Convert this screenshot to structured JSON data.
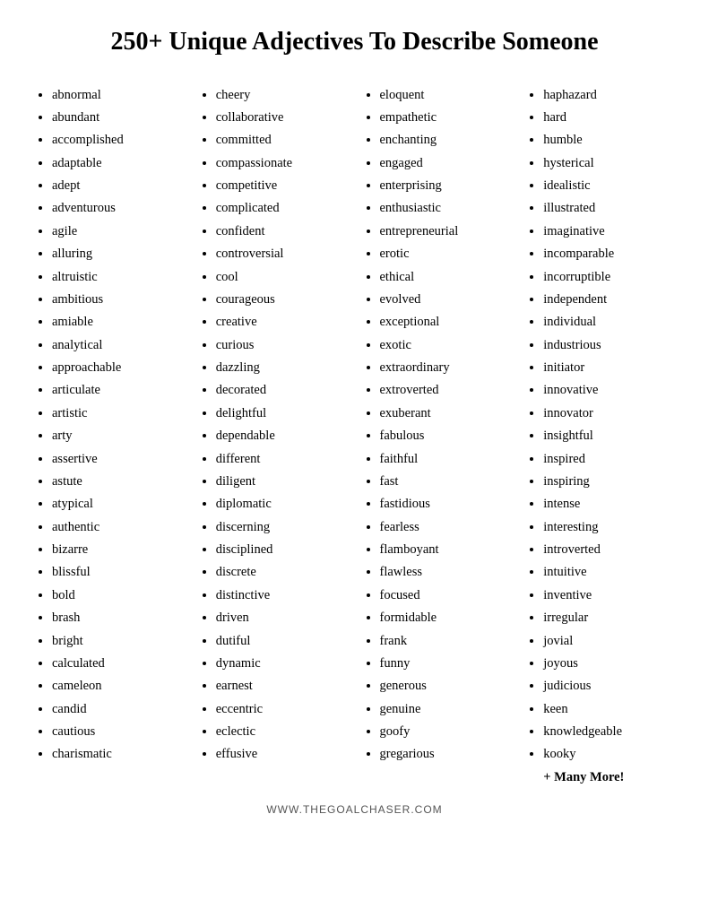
{
  "title": "250+ Unique Adjectives To Describe Someone",
  "columns": [
    {
      "id": "col1",
      "items": [
        "abnormal",
        "abundant",
        "accomplished",
        "adaptable",
        "adept",
        "adventurous",
        "agile",
        "alluring",
        "altruistic",
        "ambitious",
        "amiable",
        "analytical",
        "approachable",
        "articulate",
        "artistic",
        "arty",
        "assertive",
        "astute",
        "atypical",
        "authentic",
        "bizarre",
        "blissful",
        "bold",
        "brash",
        "bright",
        "calculated",
        "cameleon",
        "candid",
        "cautious",
        "charismatic"
      ]
    },
    {
      "id": "col2",
      "items": [
        "cheery",
        "collaborative",
        "committed",
        "compassionate",
        "competitive",
        "complicated",
        "confident",
        "controversial",
        "cool",
        "courageous",
        "creative",
        "curious",
        "dazzling",
        "decorated",
        "delightful",
        "dependable",
        "different",
        "diligent",
        "diplomatic",
        "discerning",
        "disciplined",
        "discrete",
        "distinctive",
        "driven",
        "dutiful",
        "dynamic",
        "earnest",
        "eccentric",
        "eclectic",
        "effusive"
      ]
    },
    {
      "id": "col3",
      "items": [
        "eloquent",
        "empathetic",
        "enchanting",
        "engaged",
        "enterprising",
        "enthusiastic",
        "entrepreneurial",
        "erotic",
        "ethical",
        "evolved",
        "exceptional",
        "exotic",
        "extraordinary",
        "extroverted",
        "exuberant",
        "fabulous",
        "faithful",
        "fast",
        "fastidious",
        "fearless",
        "flamboyant",
        "flawless",
        "focused",
        "formidable",
        "frank",
        "funny",
        "generous",
        "genuine",
        "goofy",
        "gregarious"
      ]
    },
    {
      "id": "col4",
      "items": [
        "haphazard",
        "hard",
        "humble",
        "hysterical",
        "idealistic",
        "illustrated",
        "imaginative",
        "incomparable",
        "incorruptible",
        "independent",
        "individual",
        "industrious",
        "initiator",
        "innovative",
        "innovator",
        "insightful",
        "inspired",
        "inspiring",
        "intense",
        "interesting",
        "introverted",
        "intuitive",
        "inventive",
        "irregular",
        "jovial",
        "joyous",
        "judicious",
        "keen",
        "knowledgeable",
        "kooky"
      ]
    }
  ],
  "many_more": "+ Many More!",
  "footer": "WWW.THEGOALCHASER.COM"
}
